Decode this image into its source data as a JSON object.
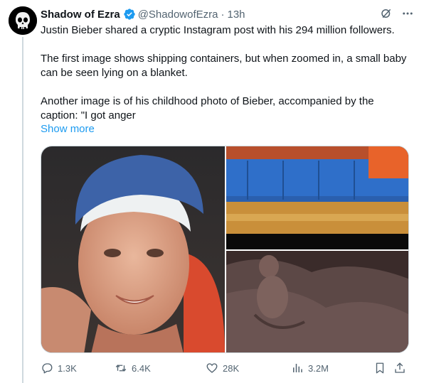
{
  "author": {
    "display_name": "Shadow of Ezra",
    "handle": "@ShadowofEzra",
    "separator": "·",
    "time": "13h",
    "verified_color": "#1d9bf0",
    "avatar_icon": "punisher-skull-icon"
  },
  "tweet": {
    "paragraphs": [
      "Justin Bieber shared a cryptic Instagram post with his 294 million followers.",
      "The first image shows shipping containers, but when zoomed in, a small baby can be seen lying on a blanket.",
      "Another image is of his childhood photo of Bieber, accompanied by the caption: \"I got anger"
    ],
    "show_more": "Show more"
  },
  "header_icons": [
    "grok-icon",
    "more-icon"
  ],
  "actions": {
    "replies": "1.3K",
    "reposts": "6.4K",
    "likes": "28K",
    "views": "3.2M"
  },
  "colors": {
    "text": "#0f1419",
    "secondary": "#536471",
    "accent": "#1d9bf0",
    "border": "#cfd9de"
  }
}
